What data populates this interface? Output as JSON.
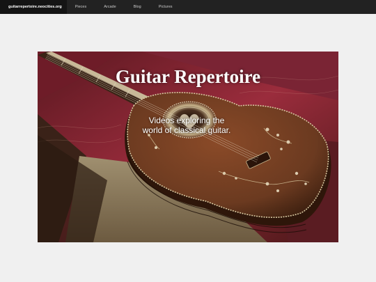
{
  "nav": {
    "brand": "guitarrepertoire.neocities.org",
    "items": [
      "Pieces",
      "Arcade",
      "Blog",
      "Pictures"
    ]
  },
  "hero": {
    "title": "Guitar Repertoire",
    "subtitle_line1": "Videos exploring the",
    "subtitle_line2": "world of classical guitar.",
    "image_subject": "ornate baroque guitar with inlaid rosette in a fabric-lined case"
  },
  "colors": {
    "topbar": "#222222",
    "brand_bg": "#141414",
    "page_bg": "#f0f0f0",
    "guitar_wood": "#6b3a20",
    "case_red": "#8a2434"
  }
}
